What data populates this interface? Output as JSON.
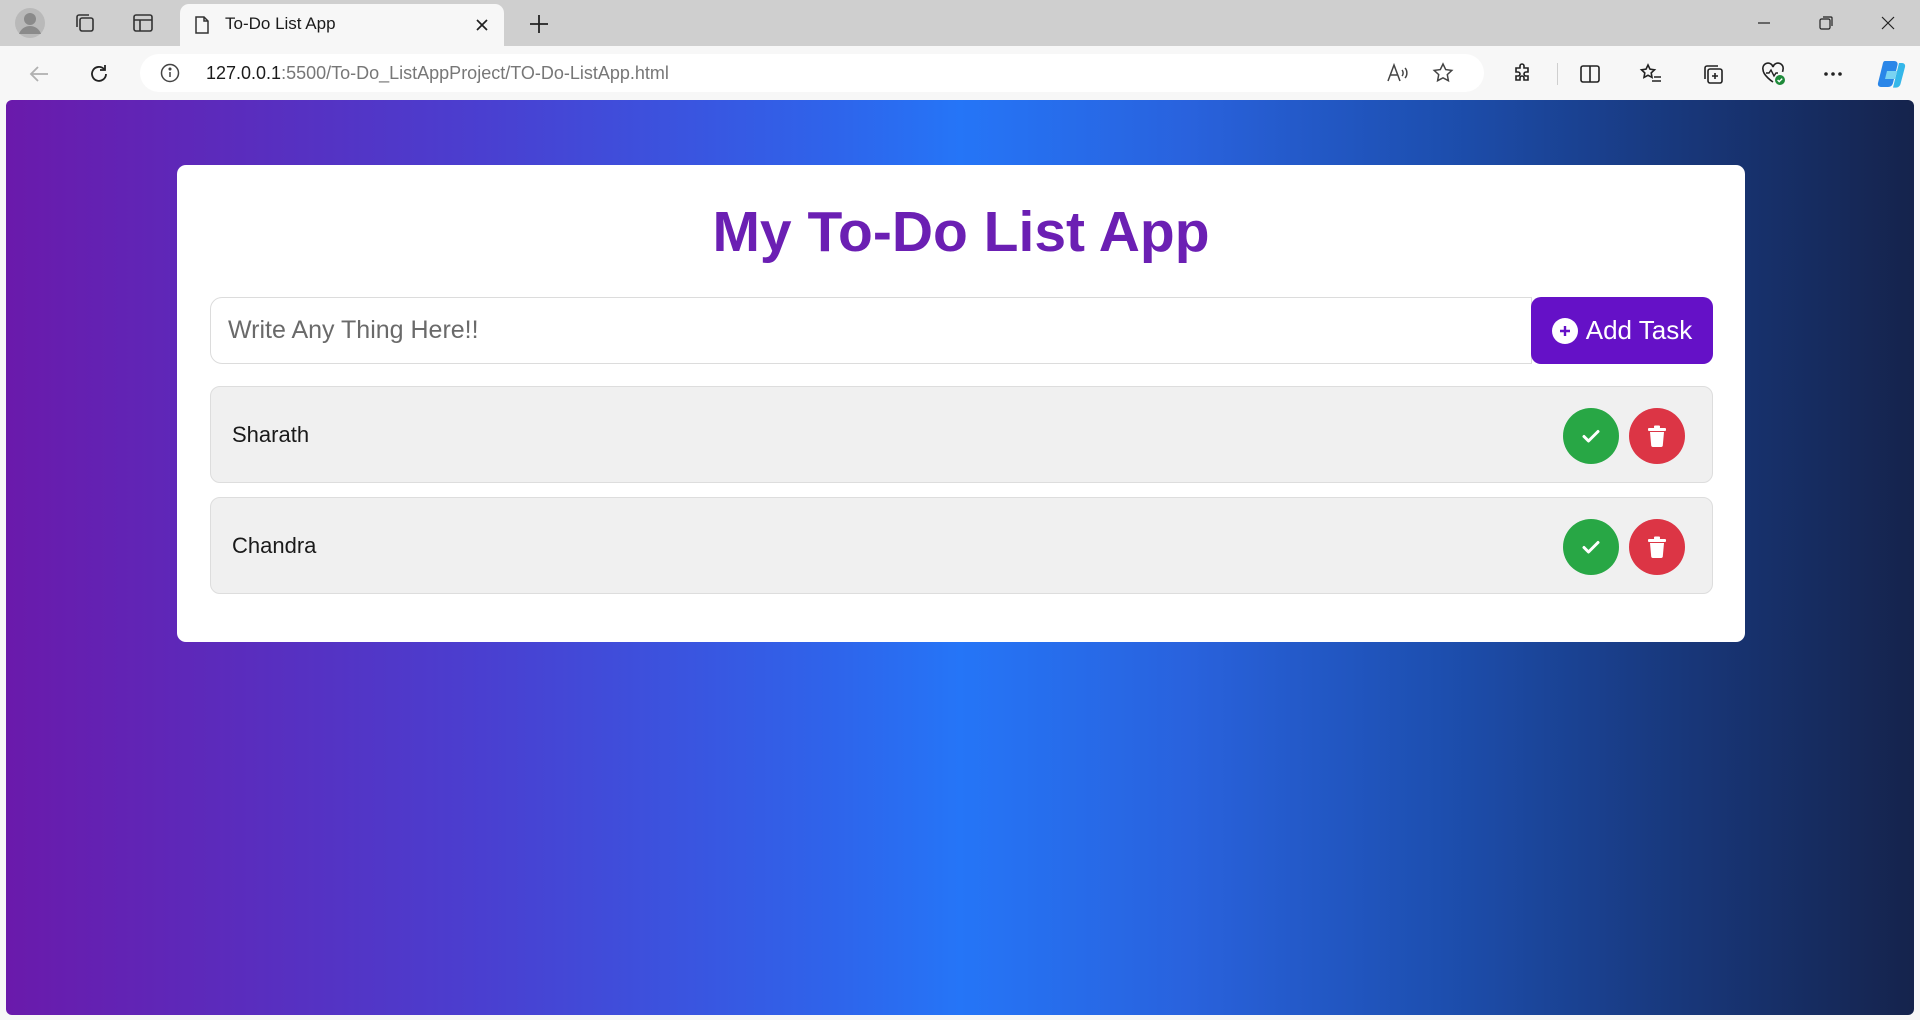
{
  "browser": {
    "tab_title": "To-Do List App",
    "url_host": "127.0.0.1",
    "url_rest": ":5500/To-Do_ListAppProject/TO-Do-ListApp.html"
  },
  "app": {
    "title": "My To-Do List App",
    "input_placeholder": "Write Any Thing Here!!",
    "add_button_label": "Add Task",
    "tasks": [
      {
        "text": "Sharath"
      },
      {
        "text": "Chandra"
      }
    ]
  },
  "colors": {
    "accent_purple": "#6511c7",
    "title_purple": "#6b1fb3",
    "complete_green": "#28a745",
    "delete_red": "#dc3545"
  },
  "icons": {
    "complete": "check-icon",
    "delete": "trash-icon",
    "add": "plus-circle-icon"
  }
}
